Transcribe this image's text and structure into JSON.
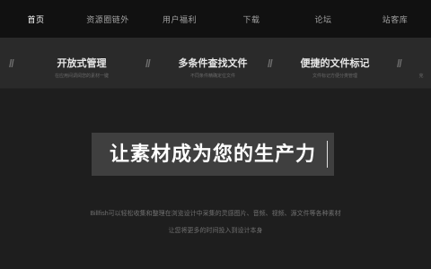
{
  "nav": {
    "items": [
      "首页",
      "资源圈链外",
      "用户福利",
      "下载",
      "论坛",
      "站客库"
    ]
  },
  "features": [
    {
      "title": "开放式管理",
      "subtitle": "在应用间调阅您的素材一键"
    },
    {
      "title": "多条件查找文件",
      "subtitle": "不同条件精确定位文件"
    },
    {
      "title": "便捷的文件标记",
      "subtitle": "文件标记方便分类管理"
    },
    {
      "title": "",
      "subtitle": "克"
    }
  ],
  "hero": {
    "title": "让素材成为您的生产力",
    "description_line1": "Billfish可以轻松收集和整理在浏览设计中采集的灵感图片、音频、视频、源文件等各种素材",
    "description_line2": "让您将更多的时间投入到设计本身"
  }
}
